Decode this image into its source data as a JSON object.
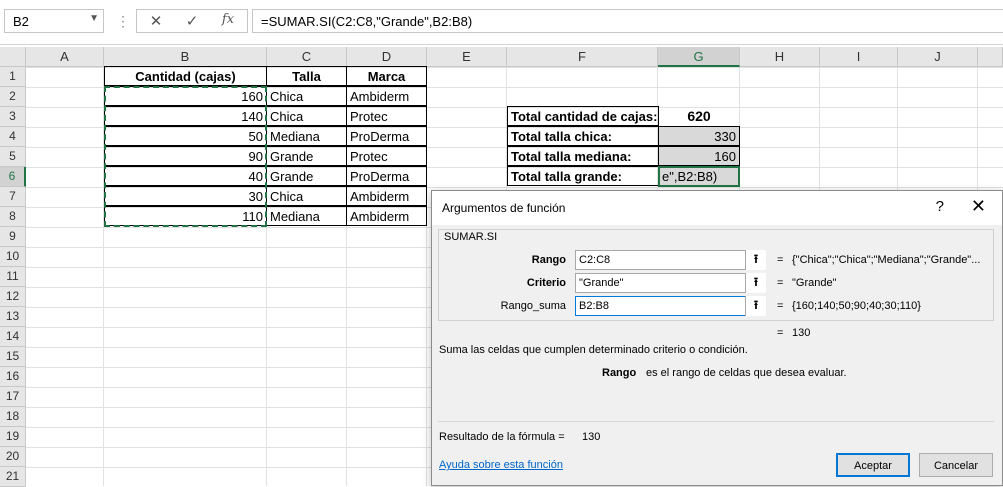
{
  "formula_bar": {
    "name_box": "B2",
    "cancel_icon": "✕",
    "enter_icon": "✓",
    "fx_icon": "fx",
    "formula": "=SUMAR.SI(C2:C8,\"Grande\",B2:B8)"
  },
  "columns": [
    "A",
    "B",
    "C",
    "D",
    "E",
    "F",
    "G",
    "H",
    "I",
    "J"
  ],
  "rows": [
    "1",
    "2",
    "3",
    "4",
    "5",
    "6",
    "7",
    "8",
    "9",
    "10",
    "11",
    "12",
    "13",
    "14",
    "15",
    "16",
    "17",
    "18",
    "19",
    "20",
    "21"
  ],
  "table": {
    "headers": [
      "Cantidad (cajas)",
      "Talla",
      "Marca"
    ],
    "rows": [
      [
        "160",
        "Chica",
        "Ambiderm"
      ],
      [
        "140",
        "Chica",
        "Protec"
      ],
      [
        "50",
        "Mediana",
        "ProDerma"
      ],
      [
        "90",
        "Grande",
        "Protec"
      ],
      [
        "40",
        "Grande",
        "ProDerma"
      ],
      [
        "30",
        "Chica",
        "Ambiderm"
      ],
      [
        "110",
        "Mediana",
        "Ambiderm"
      ]
    ]
  },
  "summary": [
    {
      "label": "Total cantidad de cajas:",
      "value": "620"
    },
    {
      "label": "Total talla chica:",
      "value": "330"
    },
    {
      "label": "Total talla mediana:",
      "value": "160"
    },
    {
      "label": "Total talla grande:",
      "value": "e\",B2:B8)"
    }
  ],
  "dialog": {
    "title": "Argumentos de función",
    "help_icon": "?",
    "close_icon": "✕",
    "function_name": "SUMAR.SI",
    "args": [
      {
        "label": "Rango",
        "input": "C2:C8",
        "value": "{\"Chica\";\"Chica\";\"Mediana\";\"Grande\"..."
      },
      {
        "label": "Criterio",
        "input": "\"Grande\"",
        "value": "\"Grande\""
      },
      {
        "label": "Rango_suma",
        "input": "B2:B8",
        "value": "{160;140;50;90;40;30;110}"
      }
    ],
    "collapse_icon": "⭱",
    "equals": "=",
    "result_inline": "130",
    "description": "Suma las celdas que cumplen determinado criterio o condición.",
    "arg_help_name": "Rango",
    "arg_help_text": "es el rango de celdas que desea evaluar.",
    "formula_result_label": "Resultado de la fórmula =",
    "formula_result_value": "130",
    "help_link": "Ayuda sobre esta función",
    "ok_label": "Aceptar",
    "cancel_label": "Cancelar"
  }
}
